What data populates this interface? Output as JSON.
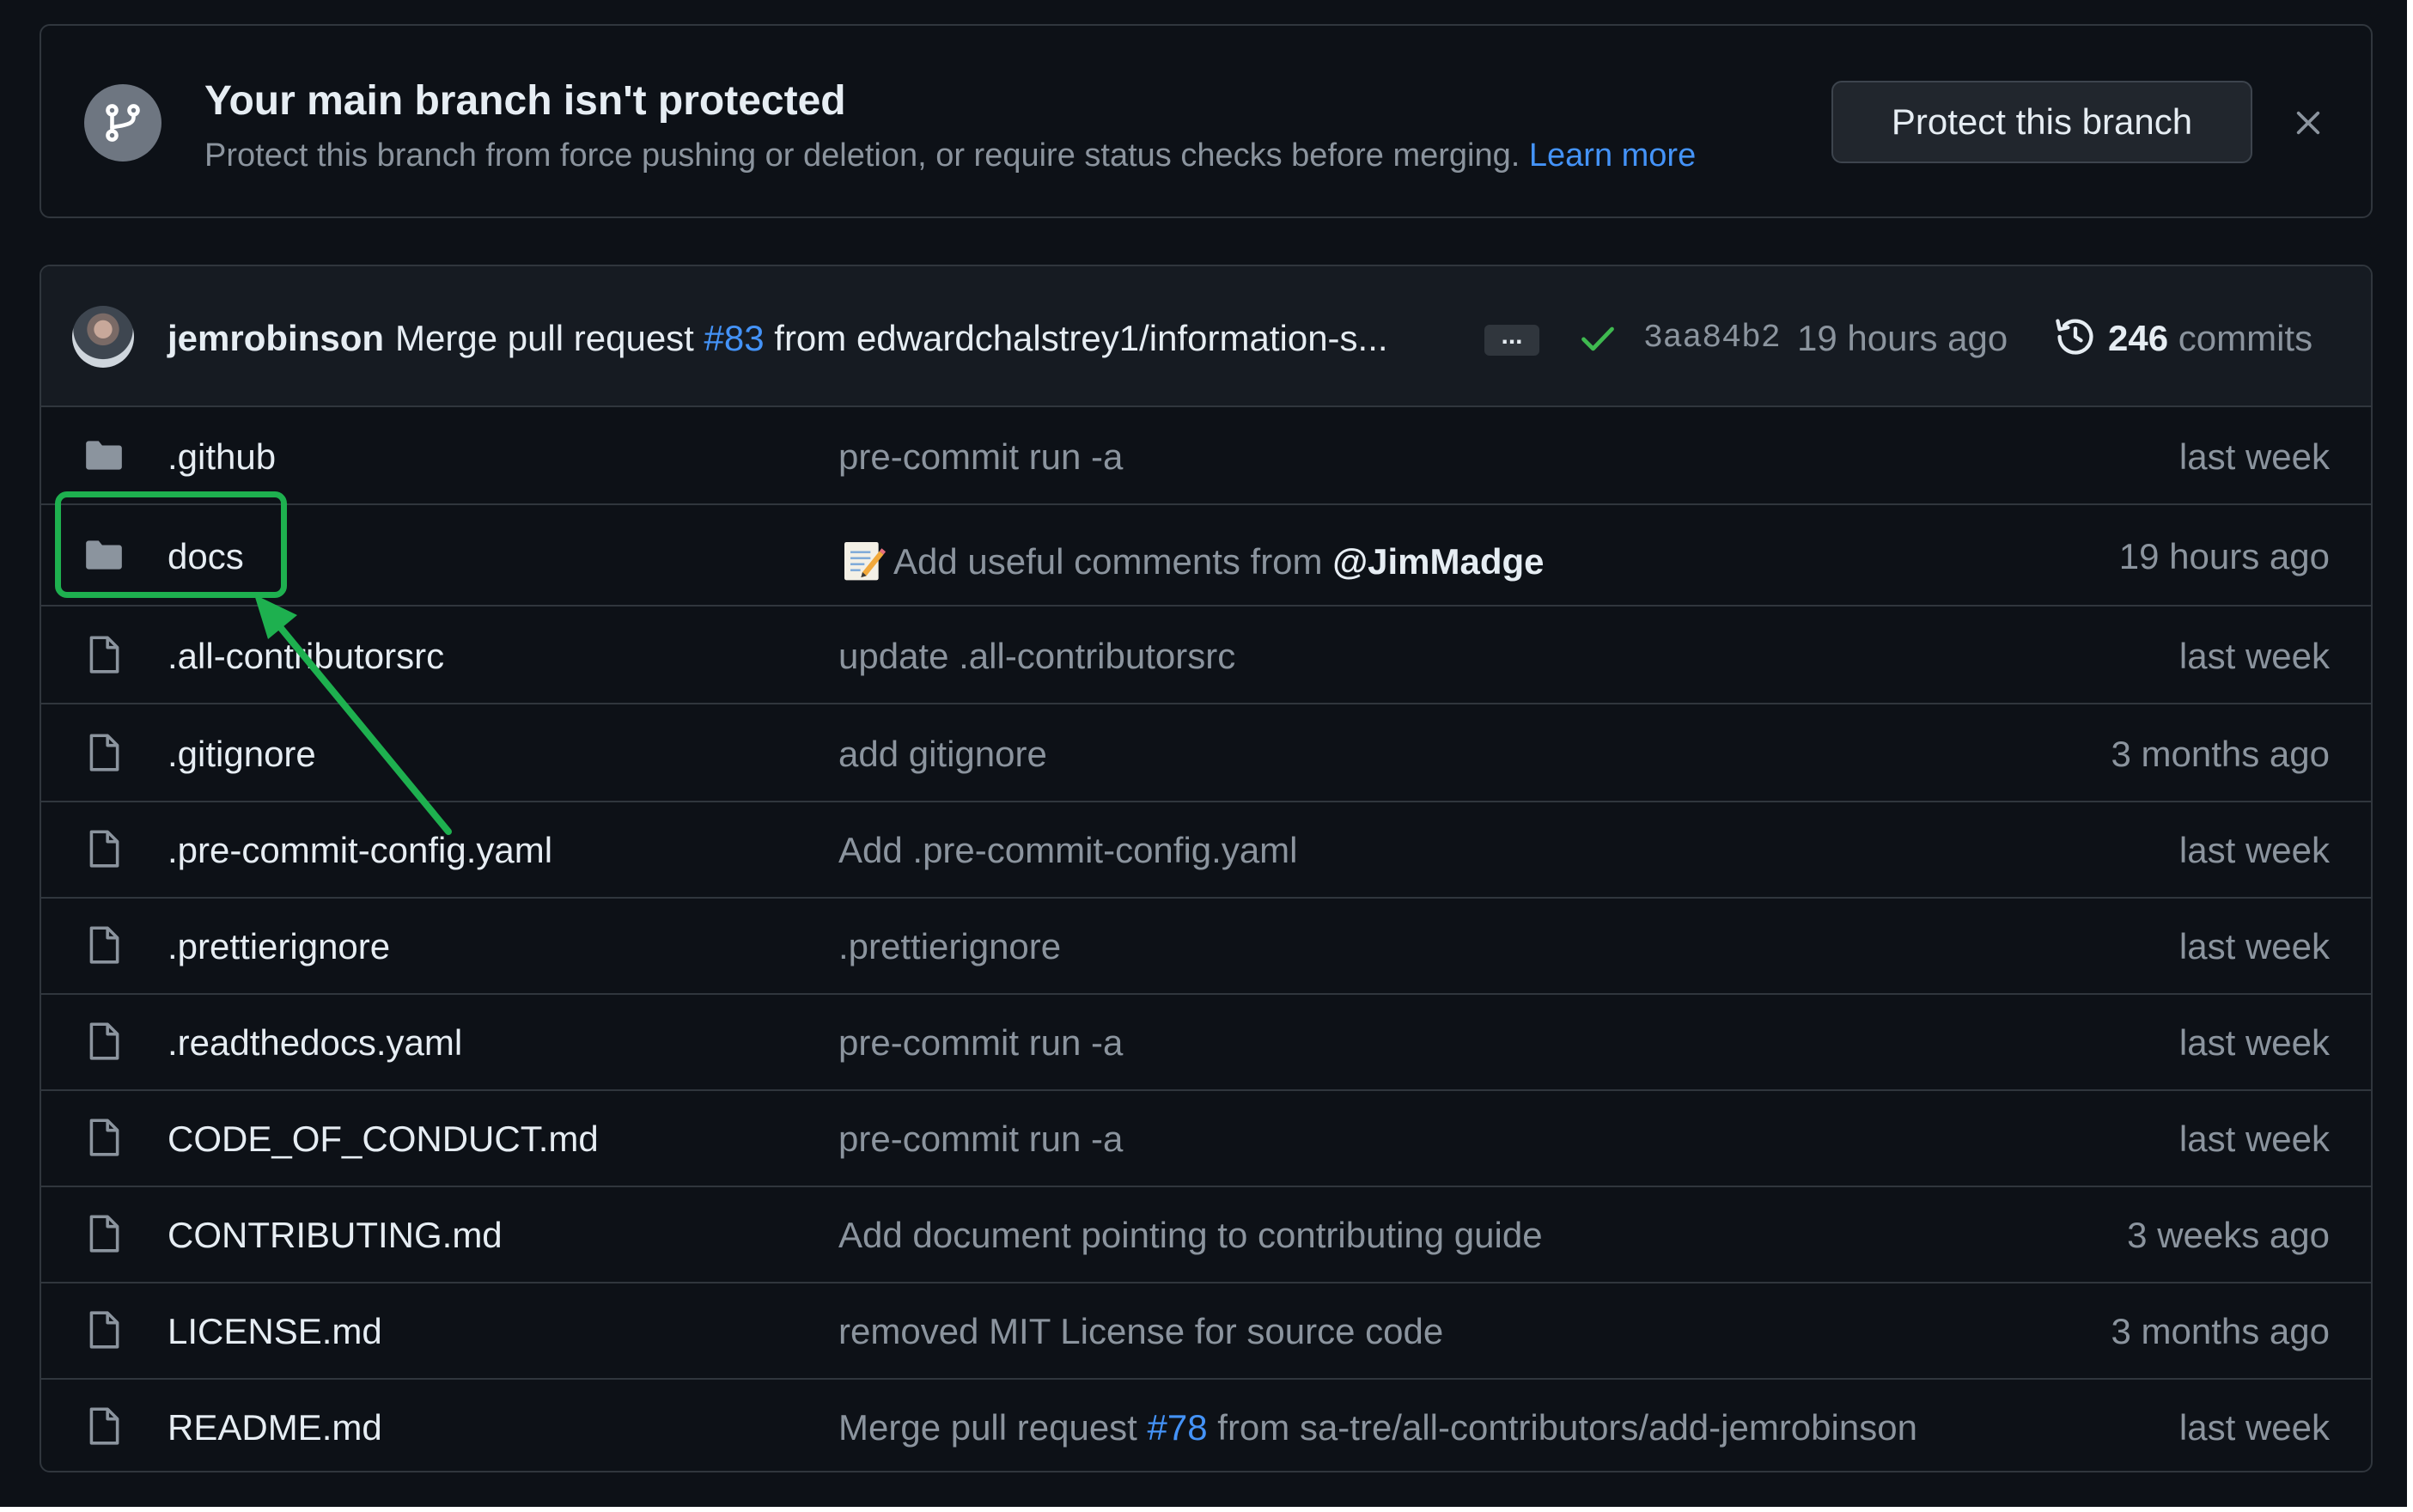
{
  "banner": {
    "title": "Your main branch isn't protected",
    "description": "Protect this branch from force pushing or deletion, or require status checks before merging.",
    "learn_more": "Learn more",
    "protect_button": "Protect this branch"
  },
  "commit": {
    "author": "jemrobinson",
    "message_prefix": "Merge pull request",
    "pr_link": "#83",
    "message_suffix": "from edwardchalstrey1/information-s...",
    "ellipsis": "...",
    "sha": "3aa84b2",
    "time": "19 hours ago",
    "count": "246",
    "count_label": "commits"
  },
  "files": [
    {
      "name": ".github",
      "type": "folder",
      "message": "pre-commit run -a",
      "time": "last week"
    },
    {
      "name": "docs",
      "type": "folder",
      "message": "Add useful comments from",
      "mention": "@JimMadge",
      "emoji": "memo",
      "time": "19 hours ago"
    },
    {
      "name": ".all-contributorsrc",
      "type": "file",
      "message": "update .all-contributorsrc",
      "time": "last week"
    },
    {
      "name": ".gitignore",
      "type": "file",
      "message": "add gitignore",
      "time": "3 months ago"
    },
    {
      "name": ".pre-commit-config.yaml",
      "type": "file",
      "message": "Add .pre-commit-config.yaml",
      "time": "last week"
    },
    {
      "name": ".prettierignore",
      "type": "file",
      "message": ".prettierignore",
      "time": "last week"
    },
    {
      "name": ".readthedocs.yaml",
      "type": "file",
      "message": "pre-commit run -a",
      "time": "last week"
    },
    {
      "name": "CODE_OF_CONDUCT.md",
      "type": "file",
      "message": "pre-commit run -a",
      "time": "last week"
    },
    {
      "name": "CONTRIBUTING.md",
      "type": "file",
      "message": "Add document pointing to contributing guide",
      "time": "3 weeks ago"
    },
    {
      "name": "LICENSE.md",
      "type": "file",
      "message": "removed MIT License for source code",
      "time": "3 months ago"
    },
    {
      "name": "README.md",
      "type": "file",
      "message_prefix": "Merge pull request",
      "pr_link": "#78",
      "message_suffix": "from sa-tre/all-contributors/add-jemrobinson",
      "time": "last week"
    }
  ],
  "icons": {
    "banner": "git-branch-icon",
    "close": "close-icon",
    "check": "check-icon",
    "history": "history-icon",
    "folder": "folder-icon",
    "file": "file-icon"
  },
  "colors": {
    "background": "#0d1117",
    "border": "#30363d",
    "text": "#e6edf3",
    "muted": "#8b949e",
    "link": "#4493f8",
    "success": "#3fb950",
    "annotation": "#1eb04f"
  }
}
